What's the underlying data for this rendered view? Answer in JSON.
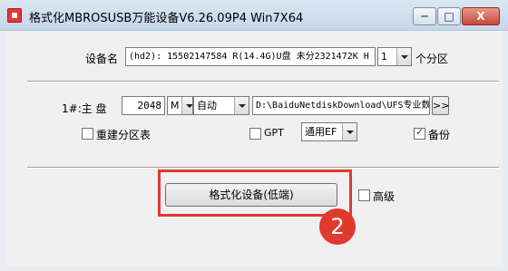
{
  "window": {
    "title": "格式化MBROSUSB万能设备V6.26.09P4 Win7X64",
    "minimize_label": "─",
    "maximize_label": "□",
    "close_label": "X"
  },
  "device": {
    "label": "设备名",
    "value": "(hd2): 15502147584 R(14.4G)U盘 未分2321472K H",
    "partition_count": "1",
    "partition_suffix": "个分区"
  },
  "partition1": {
    "label": "1#:主   盘",
    "size": "2048",
    "unit": "M",
    "fs": "自动",
    "path": "D:\\BaiduNetdiskDownload\\UFS专业数",
    "browse_label": ">>"
  },
  "options": {
    "rebuild_label": "重建分区表",
    "rebuild_checked": false,
    "gpt_label": "GPT",
    "gpt_checked": false,
    "ef_label": "通用EF",
    "backup_label": "备份",
    "backup_checked": true
  },
  "actions": {
    "format_label": "格式化设备(低端)",
    "advanced_label": "高级",
    "advanced_checked": false
  },
  "annotation": {
    "step_number": "2"
  }
}
